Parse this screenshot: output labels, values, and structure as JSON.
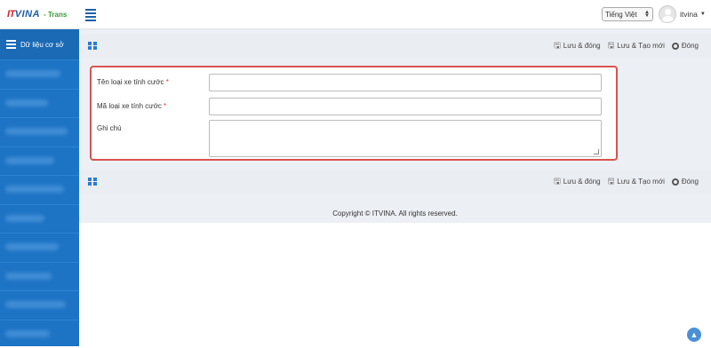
{
  "header": {
    "logo_it": "IT",
    "logo_vina": "VINA",
    "logo_suffix": "- Trans",
    "language": "Tiếng Việt",
    "username": "itvina"
  },
  "sidebar": {
    "title": "Dữ liệu cơ sở",
    "items": [
      "",
      "",
      "",
      "",
      "",
      "",
      "",
      "",
      "",
      ""
    ]
  },
  "toolbar": {
    "save_close": "Lưu & đóng",
    "save_new": "Lưu & Tạo mới",
    "close": "Đóng"
  },
  "form": {
    "fields": [
      {
        "label": "Tên loại xe tính cước",
        "required": "*",
        "value": ""
      },
      {
        "label": "Mã loại xe tính cước",
        "required": "*",
        "value": ""
      },
      {
        "label": "Ghi chú",
        "required": "",
        "value": ""
      }
    ]
  },
  "footer": {
    "copyright": "Copyright © ITVINA. All rights reserved."
  },
  "icons": {
    "menu": "hamburger-icon",
    "grid": "grid-icon",
    "save": "floppy-icon",
    "close": "circle-icon",
    "scroll_top": "arrow-up-icon"
  },
  "colors": {
    "sidebar": "#1d73c4",
    "accent": "#2b7bd4",
    "highlight_border": "#d9534f",
    "required": "#d43a3a"
  }
}
